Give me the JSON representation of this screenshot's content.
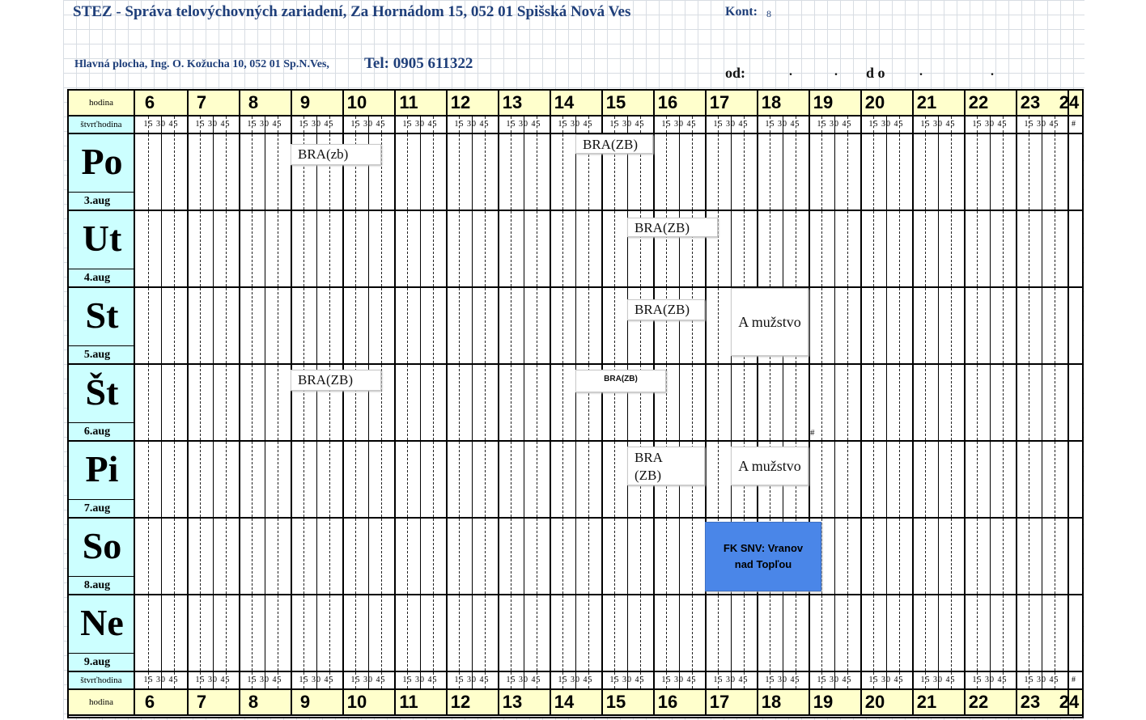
{
  "header": {
    "org_title": "STEZ - Správa telovýchovných zariadení, Za Hornádom 15, 052 01 Spišská Nová Ves",
    "kont_label": "Kont:",
    "kont_value": "8",
    "address": "Hlavná plocha, Ing. O. Kožucha 10, 052 01 Sp.N.Ves,",
    "tel": "Tel: 0905 611322",
    "od_label": "od:",
    "od_dots": ". .",
    "do_label": "d o",
    "do_dots": ". ."
  },
  "grid": {
    "hour_label": "hodina",
    "quarter_label": "štvrťhodina",
    "hours": [
      "6",
      "7",
      "8",
      "9",
      "10",
      "11",
      "12",
      "13",
      "14",
      "15",
      "16",
      "17",
      "18",
      "19",
      "20",
      "21",
      "22",
      "23",
      "24"
    ],
    "quarter_marks": "15 30 45",
    "end_mark": "#"
  },
  "days": [
    {
      "name": "Po",
      "date": "3.aug"
    },
    {
      "name": "Ut",
      "date": "4.aug"
    },
    {
      "name": "St",
      "date": "5.aug"
    },
    {
      "name": "Št",
      "date": "6.aug"
    },
    {
      "name": "Pi",
      "date": "7.aug"
    },
    {
      "name": "So",
      "date": "8.aug"
    },
    {
      "name": "Ne",
      "date": "9.aug"
    }
  ],
  "events": [
    {
      "day": 0,
      "label": "BRA(zb)",
      "start": "9:00",
      "end": "10:45"
    },
    {
      "day": 0,
      "label": "BRA(ZB)",
      "start": "14:30",
      "end": "16:00"
    },
    {
      "day": 1,
      "label": "BRA(ZB)",
      "start": "15:30",
      "end": "17:15"
    },
    {
      "day": 2,
      "label": "BRA(ZB)",
      "start": "15:30",
      "end": "17:00"
    },
    {
      "day": 2,
      "label": "A mužstvo",
      "start": "17:30",
      "end": "19:00"
    },
    {
      "day": 3,
      "label": "BRA(ZB)",
      "start": "9:00",
      "end": "10:45"
    },
    {
      "day": 3,
      "label": "BRA(ZB)",
      "start": "14:30",
      "end": "16:15"
    },
    {
      "day": 4,
      "label": "BRA (ZB)",
      "start": "15:30",
      "end": "17:00"
    },
    {
      "day": 4,
      "label": "A mužstvo",
      "start": "17:30",
      "end": "19:00"
    },
    {
      "day": 5,
      "label": "FK SNV: Vranov nad Topľou",
      "start": "17:00",
      "end": "19:15",
      "color": "#4a86e8"
    }
  ],
  "misc": {
    "hash_mark": "#"
  }
}
